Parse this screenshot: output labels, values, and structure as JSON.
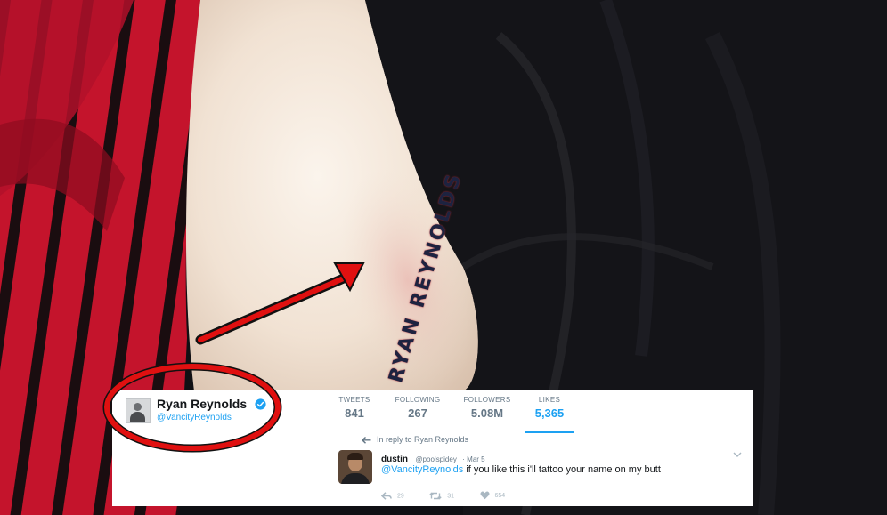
{
  "tattoo": {
    "text": "RYAN REYNOLDS"
  },
  "profile": {
    "name": "Ryan Reynolds",
    "handle": "@VancityReynolds"
  },
  "stats": [
    {
      "label": "TWEETS",
      "value": "841"
    },
    {
      "label": "FOLLOWING",
      "value": "267"
    },
    {
      "label": "FOLLOWERS",
      "value": "5.08M"
    },
    {
      "label": "LIKES",
      "value": "5,365"
    }
  ],
  "reply": {
    "context": "In reply to Ryan Reynolds",
    "author": "dustin",
    "author_handle": "@poolspidey",
    "date": "· Mar 5",
    "mention": "@VancityReynolds",
    "body": " if you like this i'll tattoo your name on my butt",
    "reply_count": "29",
    "retweet_count": "31",
    "like_count": "654"
  },
  "colors": {
    "twitter_blue": "#1da1f2",
    "annotation_red": "#e01010",
    "shirt_red": "#c8102e"
  },
  "icons": [
    "verified-badge-icon",
    "reply-arrow-icon",
    "caret-down-icon",
    "reply-icon",
    "retweet-icon",
    "like-icon"
  ]
}
